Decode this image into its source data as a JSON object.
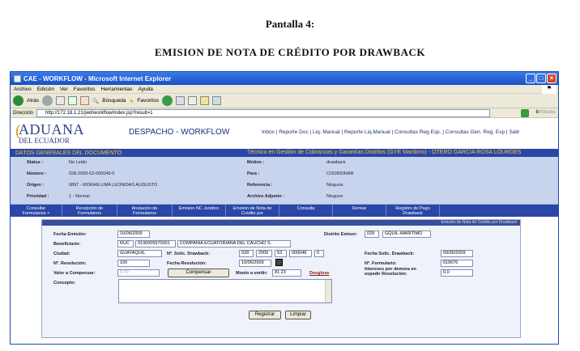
{
  "doc": {
    "pantalla": "Pantalla 4:",
    "heading": "EMISION DE NOTA DE CRÉDITO POR DRAWBACK"
  },
  "browser": {
    "title": "CAE - WORKFLOW - Microsoft Internet Explorer",
    "menu": [
      "Archivo",
      "Edición",
      "Ver",
      "Favoritos",
      "Herramientas",
      "Ayuda"
    ],
    "back": "Atrás",
    "search": "Búsqueda",
    "favorites": "Favoritos",
    "address_label": "Dirección",
    "address": "http://172.18.1.21/jwd/workflow/index.jsp?result=1",
    "go": "Ir",
    "links": "Vínculos"
  },
  "app": {
    "logo_line1": "ADUANA",
    "logo_line2": "DEL ECUADOR",
    "name": "DESPACHO - WORKFLOW",
    "nav": [
      "Inbox",
      "Reporte Doc",
      "Liq. Manual",
      "Reporte Liq.Manual",
      "Consultas Reg.Esp.",
      "Consultas Gen. Reg. Esp",
      "Salir"
    ]
  },
  "section": {
    "left": "DATOS GENERALES DEL DOCUMENTO",
    "right": "Técnico en Gestión de Cobranzas y Garantías Distritos (GYE Marítimo) - OTERO GARCIA ROSA LOURDES"
  },
  "general": {
    "status_l": "Status :",
    "status_v": "No Leido",
    "numero_l": "Número :",
    "numero_v": "028-2009-53-000049-0",
    "origen_l": "Origen :",
    "origen_v": "6897 - MORAN LIMA LEONIDAS AUGUSTO",
    "prioridad_l": "Prioridad :",
    "prioridad_v": "1 - Normal",
    "motivo_l": "Motivo :",
    "motivo_v": "drawback",
    "para_l": "Para :",
    "para_v": "COORDINAR",
    "referencia_l": "Referencia :",
    "referencia_v": "Ninguna",
    "adjunto_l": "Archivo Adjunto :",
    "adjunto_v": "Ninguno"
  },
  "tabs": [
    {
      "line1": "Consultar",
      "line2": "Formularios ×"
    },
    {
      "line1": "Recepción de",
      "line2": "Formularios"
    },
    {
      "line1": "Anulación de",
      "line2": "Formularios"
    },
    {
      "line1": "",
      "line2": "Emision NC Juridico"
    },
    {
      "line1": "Emision de Nota de",
      "line2": "Crédito por"
    },
    {
      "line1": "",
      "line2": "Consulta"
    },
    {
      "line1": "",
      "line2": "Derivar"
    },
    {
      "line1": "Registro de Pago",
      "line2": "Drawback"
    }
  ],
  "form": {
    "title": "Emisión de Nota de Crédito por Drawback",
    "fecha_emision_l": "Fecha Emisión:",
    "fecha_emision_v": "10/06/2009",
    "distrito_l": "Distrito Emisor:",
    "distrito_code": "028",
    "distrito_name": "GQUIL-MARITIMO",
    "beneficiario_l": "Beneficiario:",
    "ben_tipo": "RUC",
    "ben_id": "0190005970001",
    "ben_name": "COMPAÑÍA ECUATORIANA DEL CAUCHO S.",
    "ciudad_l": "Ciudad:",
    "ciudad_v": "GUAYAQUIL",
    "solic_l": "Nº. Solic. Drawback:",
    "solic_1": "028",
    "solic_2": "2009",
    "solic_3": "53",
    "solic_4": "000048",
    "solic_5": "0",
    "fsolic_l": "Fecha Solic. Drawback:",
    "fsolic_v": "09/06/2009",
    "resol_l": "Nº. Resolución:",
    "resol_v": "100",
    "fresol_l": "Fecha Resolución:",
    "fresol_v": "10/06/2009",
    "formulario_l": "Nº. Formulario:",
    "formulario_v": "015676",
    "valor_l": "Valor a Compensar:",
    "valor_v": "0.00",
    "compensar_btn": "Compensar",
    "monto_l": "Monto a emitir:",
    "monto_v": "81.23",
    "desglose": "Desglose",
    "intereses_l1": "Intereses por demora en",
    "intereses_l2": "expedir Resolución:",
    "intereses_v": "0.0",
    "concepto_l": "Concepto:",
    "registrar_btn": "Registrar",
    "limpiar_btn": "Limpiar"
  }
}
